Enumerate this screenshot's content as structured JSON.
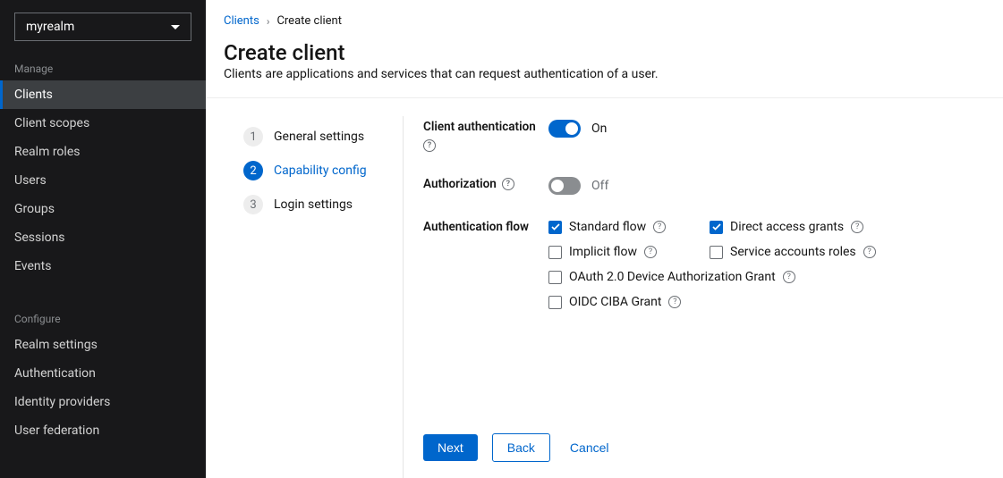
{
  "realm_selector": {
    "value": "myrealm"
  },
  "sidebar": {
    "section_manage": "Manage",
    "section_configure": "Configure",
    "manage_items": [
      {
        "label": "Clients",
        "active": true
      },
      {
        "label": "Client scopes"
      },
      {
        "label": "Realm roles"
      },
      {
        "label": "Users"
      },
      {
        "label": "Groups"
      },
      {
        "label": "Sessions"
      },
      {
        "label": "Events"
      }
    ],
    "configure_items": [
      {
        "label": "Realm settings"
      },
      {
        "label": "Authentication"
      },
      {
        "label": "Identity providers"
      },
      {
        "label": "User federation"
      }
    ]
  },
  "breadcrumb": {
    "parent": "Clients",
    "current": "Create client"
  },
  "page": {
    "title": "Create client",
    "description": "Clients are applications and services that can request authentication of a user."
  },
  "wizard": {
    "steps": [
      {
        "num": "1",
        "label": "General settings"
      },
      {
        "num": "2",
        "label": "Capability config"
      },
      {
        "num": "3",
        "label": "Login settings"
      }
    ],
    "active_index": 1
  },
  "form": {
    "client_auth_label": "Client authentication",
    "client_auth_state": "On",
    "authorization_label": "Authorization",
    "authorization_state": "Off",
    "auth_flow_label": "Authentication flow",
    "flows": {
      "standard": {
        "label": "Standard flow",
        "checked": true
      },
      "direct": {
        "label": "Direct access grants",
        "checked": true
      },
      "implicit": {
        "label": "Implicit flow",
        "checked": false
      },
      "service": {
        "label": "Service accounts roles",
        "checked": false
      },
      "device": {
        "label": "OAuth 2.0 Device Authorization Grant",
        "checked": false
      },
      "ciba": {
        "label": "OIDC CIBA Grant",
        "checked": false
      }
    }
  },
  "buttons": {
    "next": "Next",
    "back": "Back",
    "cancel": "Cancel"
  }
}
